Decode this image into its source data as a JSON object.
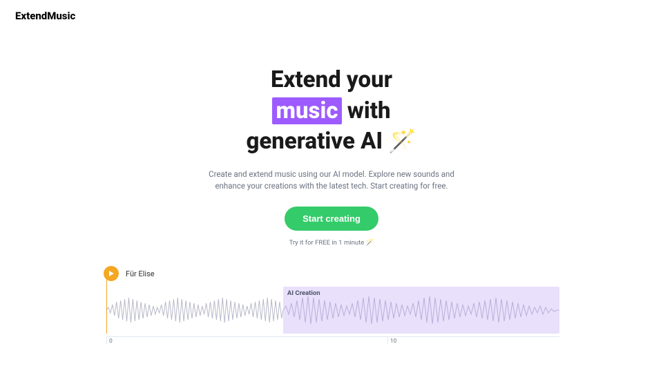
{
  "header": {
    "logo": "ExtendMusic"
  },
  "hero": {
    "title_line1": "Extend your",
    "title_highlight": "music",
    "title_line2_after": " with",
    "title_line3": "generative AI 🪄",
    "subtitle": "Create and extend music using our AI model. Explore new sounds and enhance your creations with the latest tech. Start creating for free.",
    "cta_label": "Start creating",
    "cta_note": "Try it for FREE in 1 minute 🪄"
  },
  "track": {
    "title": "Für Elise",
    "ai_label": "AI Creation",
    "ticks": {
      "t0": "0",
      "t10": "10"
    }
  },
  "colors": {
    "accent_purple": "#9d5bff",
    "cta_green": "#34cb6a",
    "play_orange": "#f5a623"
  }
}
